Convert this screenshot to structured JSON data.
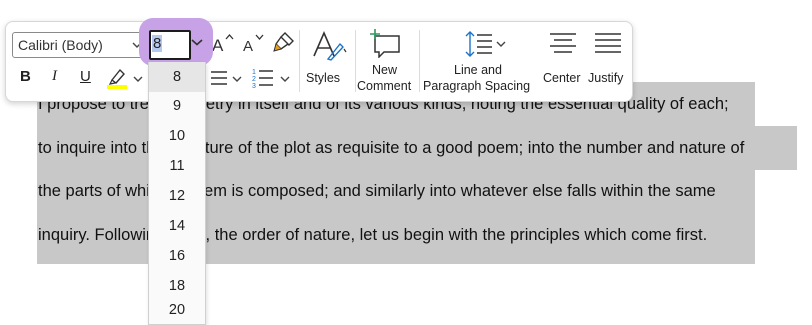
{
  "document": {
    "lines": [
      "I propose to treat of Poetry in itself and of its various kinds, noting the essential quality of each;",
      "to inquire into the structure of the plot as requisite to a good poem; into the number and nature of",
      "the parts of which a poem is composed; and similarly into whatever else falls within the same",
      "inquiry. Following, then, the order of nature, let us begin with the principles which come first."
    ]
  },
  "toolbar": {
    "font_name": "Calibri (Body)",
    "font_size": "8",
    "styles_label": "Styles",
    "new_comment_label_1": "New",
    "new_comment_label_2": "Comment",
    "spacing_label_1": "Line and",
    "spacing_label_2": "Paragraph Spacing",
    "center_label": "Center",
    "justify_label": "Justify",
    "bold_label": "B",
    "italic_label": "I",
    "underline_label": "U",
    "highlight_color": "#ffff00",
    "accent_highlight": "#c7a2e6"
  },
  "font_size_list": {
    "items": [
      "8",
      "9",
      "10",
      "11",
      "12",
      "14",
      "16",
      "18",
      "20"
    ],
    "selected": "8"
  },
  "colors": {
    "selection": "#c8c8c8",
    "icon": "#333333",
    "blue_icon": "#1a73c8",
    "green_icon": "#2e9a5a"
  }
}
